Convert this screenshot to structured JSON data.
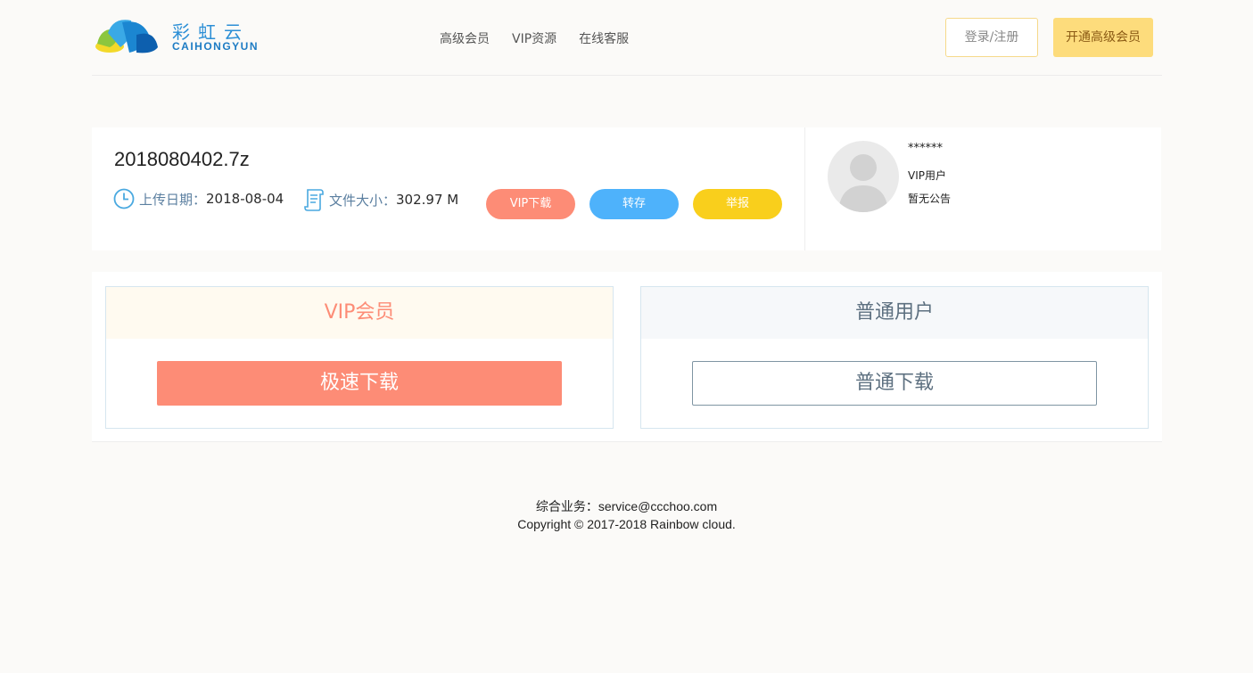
{
  "header": {
    "logo": {
      "cn": "彩虹云",
      "en": "CAIHONGYUN"
    },
    "nav": [
      "高级会员",
      "VIP资源",
      "在线客服"
    ],
    "login_label": "登录/注册",
    "open_vip_label": "开通高级会员"
  },
  "file": {
    "name": "2018080402.7z",
    "upload_date_label": "上传日期：",
    "upload_date": "2018-08-04",
    "size_label": "文件大小：",
    "size": "302.97 M",
    "actions": {
      "vip_download": "VIP下载",
      "save": "转存",
      "report": "举报"
    }
  },
  "user": {
    "name": "******",
    "type": "VIP用户",
    "notice": "暂无公告"
  },
  "download": {
    "vip": {
      "title": "VIP会员",
      "button": "极速下载"
    },
    "normal": {
      "title": "普通用户",
      "button": "普通下载"
    }
  },
  "footer": {
    "contact": "综合业务：service@ccchoo.com",
    "copyright": "Copyright © 2017-2018 Rainbow cloud."
  },
  "colors": {
    "accent_salmon": "#fd8c76",
    "accent_blue": "#4eb2fb",
    "accent_yellow": "#f9cf1c",
    "vip_button": "#fddc7c"
  }
}
